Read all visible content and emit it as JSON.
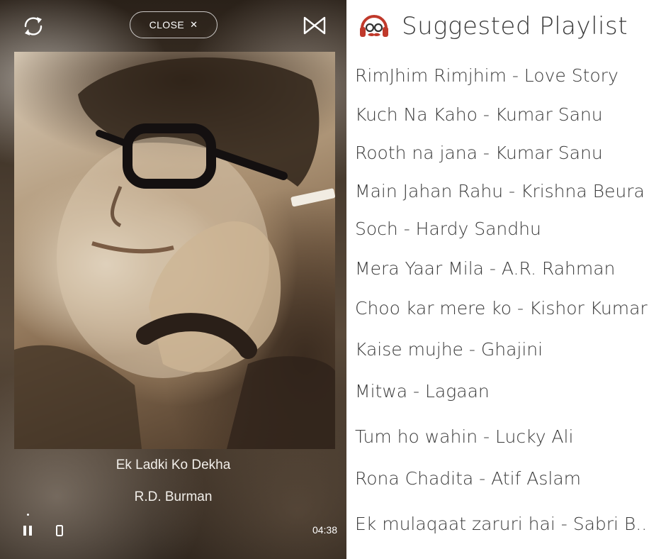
{
  "player": {
    "close_label": "CLOSE",
    "close_glyph": "✕",
    "track_title": "Ek Ladki Ko Dekha",
    "artist": "R.D. Burman",
    "duration": "04:38",
    "is_playing": true,
    "icons": {
      "refresh": "refresh-icon",
      "shuffle": "bowtie-shuffle-icon",
      "pause": "pause-icon",
      "device": "phone-device-icon",
      "album_art": "album-art-portrait"
    }
  },
  "playlist": {
    "title": "Suggested Playlist",
    "logo_icon": "headphones-glasses-mustache-logo",
    "accent_color": "#c0392b",
    "items": [
      {
        "label": "RimJhim Rimjhim - Love Story"
      },
      {
        "label": "Kuch Na Kaho - Kumar Sanu"
      },
      {
        "label": "Rooth na jana - Kumar Sanu"
      },
      {
        "label": "Main Jahan Rahu - Krishna Beura"
      },
      {
        "label": "Soch - Hardy Sandhu"
      },
      {
        "label": "Mera Yaar Mila - A.R. Rahman"
      },
      {
        "label": "Choo kar mere ko - Kishor Kumar"
      },
      {
        "label": "Kaise mujhe - Ghajini"
      },
      {
        "label": "Mitwa - Lagaan"
      },
      {
        "label": "Tum ho wahin - Lucky Ali"
      },
      {
        "label": "Rona Chadita - Atif Aslam"
      },
      {
        "label": "Ek mulaqaat zaruri hai - Sabri B.."
      }
    ]
  }
}
